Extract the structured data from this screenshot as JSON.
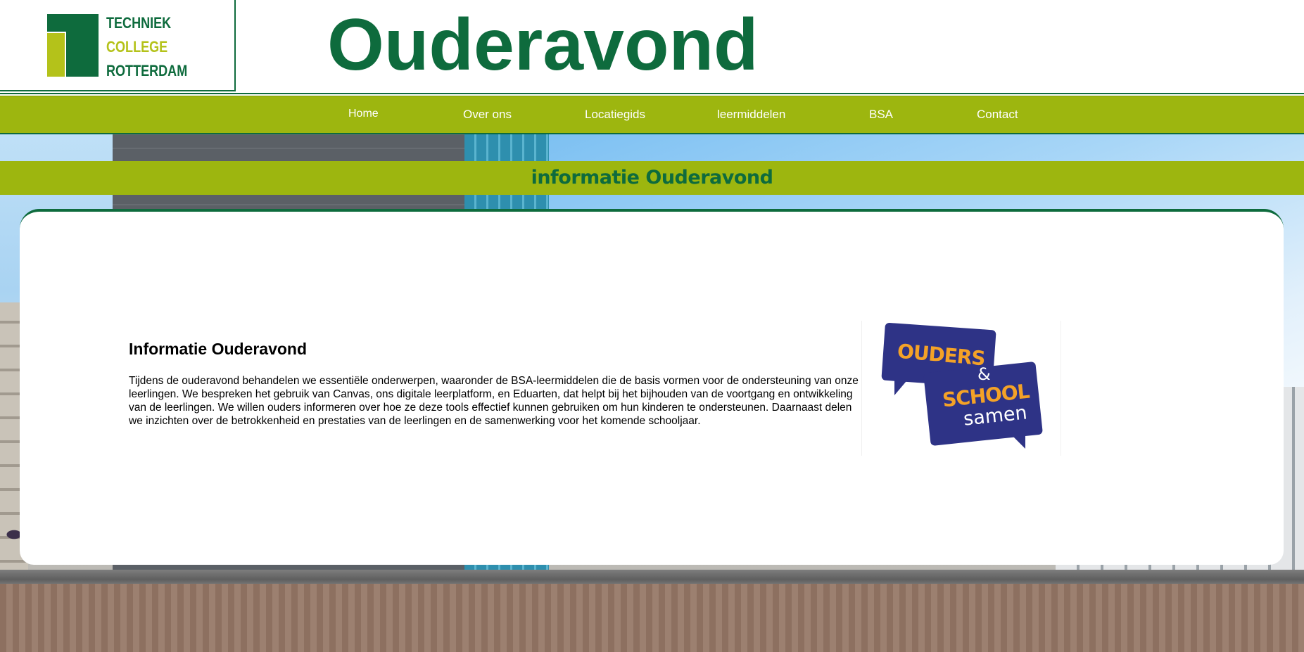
{
  "header": {
    "logo": {
      "line1": "TECHNIEK",
      "line2": "COLLEGE",
      "line3": "ROTTERDAM"
    },
    "title": "Ouderavond"
  },
  "nav": {
    "items": [
      {
        "label": "Home"
      },
      {
        "label": "Over ons"
      },
      {
        "label": "Locatiegids"
      },
      {
        "label": "leermiddelen"
      },
      {
        "label": "BSA"
      },
      {
        "label": "Contact"
      }
    ]
  },
  "banner": {
    "title": "informatie Ouderavond"
  },
  "content": {
    "heading": "Informatie Ouderavond",
    "body": "Tijdens de ouderavond behandelen we essentiële onderwerpen, waaronder de BSA-leermiddelen die de basis vormen voor de ondersteuning van onze leerlingen. We bespreken het gebruik van Canvas, ons digitale leerplatform, en Eduarten, dat helpt bij het bijhouden van de voortgang en ontwikkeling van de leerlingen. We willen ouders informeren over hoe ze deze tools effectief kunnen gebruiken om hun kinderen te ondersteunen. Daarnaast delen we inzichten over de betrokkenheid en prestaties van de leerlingen en de samenwerking voor het komende schooljaar.",
    "image": {
      "word1": "OUDERS",
      "word2": "&",
      "word3": "SCHOOL",
      "word4": "samen"
    }
  },
  "colors": {
    "brand_green": "#0e6b3d",
    "lime": "#9db60f",
    "logo_lime": "#b4c21a",
    "bubble_blue": "#2e3386",
    "bubble_orange": "#f4a227"
  }
}
